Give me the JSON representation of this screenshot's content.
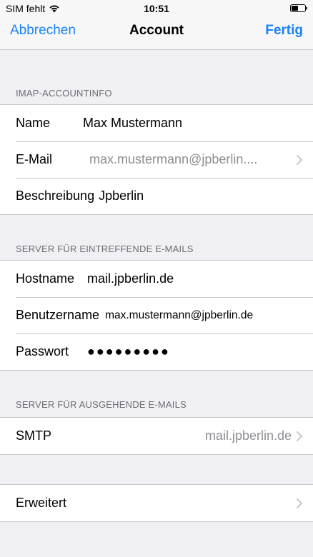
{
  "status_bar": {
    "carrier": "SIM fehlt",
    "time": "10:51"
  },
  "nav": {
    "cancel": "Abbrechen",
    "title": "Account",
    "done": "Fertig"
  },
  "sections": {
    "imap": {
      "header": "IMAP-ACCOUNTINFO",
      "name_label": "Name",
      "name_value": "Max Mustermann",
      "email_label": "E-Mail",
      "email_value": "max.mustermann@jpberlin....",
      "description_label": "Beschreibung",
      "description_value": "Jpberlin"
    },
    "incoming": {
      "header": "SERVER FÜR EINTREFFENDE E-MAILS",
      "hostname_label": "Hostname",
      "hostname_value": "mail.jpberlin.de",
      "username_label": "Benutzername",
      "username_value": "max.mustermann@jpberlin.de",
      "password_label": "Passwort",
      "password_value": "●●●●●●●●●"
    },
    "outgoing": {
      "header": "SERVER FÜR AUSGEHENDE E-MAILS",
      "smtp_label": "SMTP",
      "smtp_value": "mail.jpberlin.de"
    },
    "advanced": {
      "label": "Erweitert"
    }
  },
  "colors": {
    "accent": "#1a82fb",
    "background": "#efeff4",
    "secondary_text": "#8e8e93"
  }
}
